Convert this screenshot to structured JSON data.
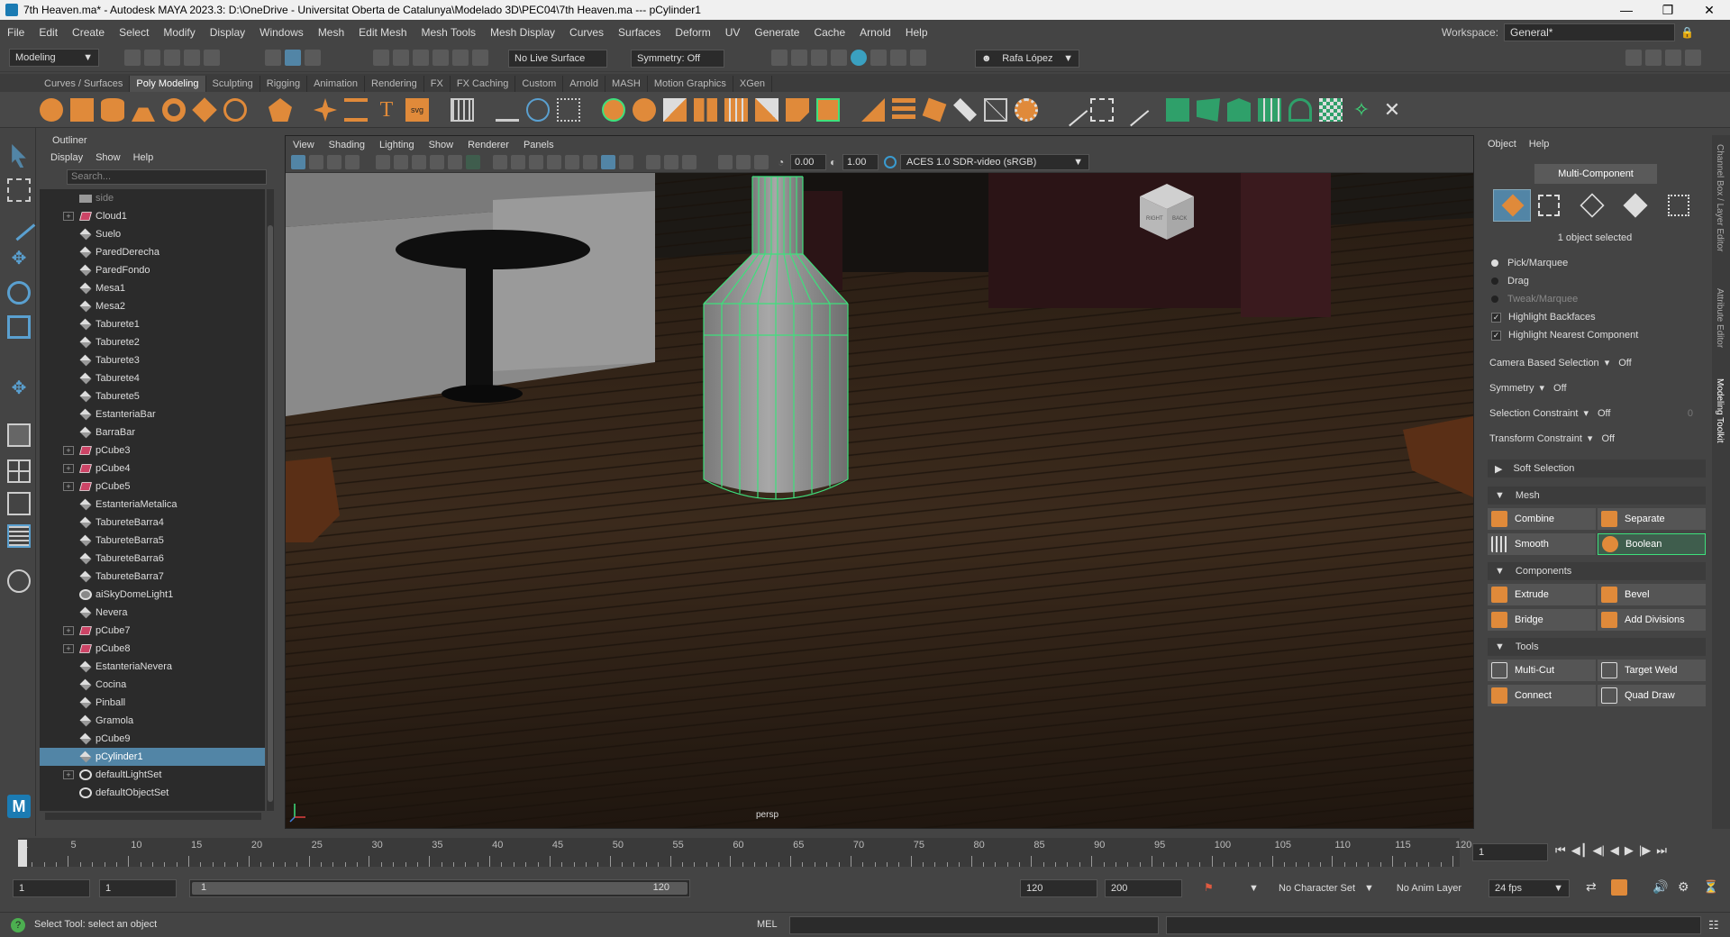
{
  "window": {
    "title": "7th Heaven.ma* - Autodesk MAYA 2023.3: D:\\OneDrive - Universitat Oberta de Catalunya\\Modelado 3D\\PEC04\\7th Heaven.ma   ---   pCylinder1"
  },
  "menubar": {
    "items": [
      "File",
      "Edit",
      "Create",
      "Select",
      "Modify",
      "Display",
      "Windows",
      "Mesh",
      "Edit Mesh",
      "Mesh Tools",
      "Mesh Display",
      "Curves",
      "Surfaces",
      "Deform",
      "UV",
      "Generate",
      "Cache",
      "Arnold",
      "Help"
    ],
    "workspace_label": "Workspace:",
    "workspace_value": "General*"
  },
  "statusline": {
    "mode": "Modeling",
    "live_surface": "No Live Surface",
    "symmetry": "Symmetry: Off",
    "user": "Rafa López"
  },
  "shelf": {
    "tabs": [
      "Curves / Surfaces",
      "Poly Modeling",
      "Sculpting",
      "Rigging",
      "Animation",
      "Rendering",
      "FX",
      "FX Caching",
      "Custom",
      "Arnold",
      "MASH",
      "Motion Graphics",
      "XGen"
    ],
    "active_tab": "Poly Modeling"
  },
  "outliner": {
    "title": "Outliner",
    "menu": [
      "Display",
      "Show",
      "Help"
    ],
    "search_placeholder": "Search...",
    "items": [
      {
        "label": "side",
        "icon": "camera-icon",
        "expandable": false
      },
      {
        "label": "Cloud1",
        "icon": "group-icon",
        "expandable": true
      },
      {
        "label": "Suelo",
        "icon": "mesh-icon",
        "expandable": false
      },
      {
        "label": "ParedDerecha",
        "icon": "mesh-icon",
        "expandable": false
      },
      {
        "label": "ParedFondo",
        "icon": "mesh-icon",
        "expandable": false
      },
      {
        "label": "Mesa1",
        "icon": "mesh-icon",
        "expandable": false
      },
      {
        "label": "Mesa2",
        "icon": "mesh-icon",
        "expandable": false
      },
      {
        "label": "Taburete1",
        "icon": "mesh-icon",
        "expandable": false
      },
      {
        "label": "Taburete2",
        "icon": "mesh-icon",
        "expandable": false
      },
      {
        "label": "Taburete3",
        "icon": "mesh-icon",
        "expandable": false
      },
      {
        "label": "Taburete4",
        "icon": "mesh-icon",
        "expandable": false
      },
      {
        "label": "Taburete5",
        "icon": "mesh-icon",
        "expandable": false
      },
      {
        "label": "EstanteriaBar",
        "icon": "mesh-icon",
        "expandable": false
      },
      {
        "label": "BarraBar",
        "icon": "mesh-icon",
        "expandable": false
      },
      {
        "label": "pCube3",
        "icon": "group-icon",
        "expandable": true
      },
      {
        "label": "pCube4",
        "icon": "group-icon",
        "expandable": true
      },
      {
        "label": "pCube5",
        "icon": "group-icon",
        "expandable": true
      },
      {
        "label": "EstanteriaMetalica",
        "icon": "mesh-icon",
        "expandable": false
      },
      {
        "label": "TabureteBarra4",
        "icon": "mesh-icon",
        "expandable": false
      },
      {
        "label": "TabureteBarra5",
        "icon": "mesh-icon",
        "expandable": false
      },
      {
        "label": "TabureteBarra6",
        "icon": "mesh-icon",
        "expandable": false
      },
      {
        "label": "TabureteBarra7",
        "icon": "mesh-icon",
        "expandable": false
      },
      {
        "label": "aiSkyDomeLight1",
        "icon": "light-icon",
        "expandable": false
      },
      {
        "label": "Nevera",
        "icon": "mesh-icon",
        "expandable": false
      },
      {
        "label": "pCube7",
        "icon": "group-icon",
        "expandable": true
      },
      {
        "label": "pCube8",
        "icon": "group-icon",
        "expandable": true
      },
      {
        "label": "EstanteriaNevera",
        "icon": "mesh-icon",
        "expandable": false
      },
      {
        "label": "Cocina",
        "icon": "mesh-icon",
        "expandable": false
      },
      {
        "label": "Pinball",
        "icon": "mesh-icon",
        "expandable": false
      },
      {
        "label": "Gramola",
        "icon": "mesh-icon",
        "expandable": false
      },
      {
        "label": "pCube9",
        "icon": "mesh-icon",
        "expandable": false
      },
      {
        "label": "pCylinder1",
        "icon": "mesh-icon",
        "expandable": false,
        "selected": true
      },
      {
        "label": "defaultLightSet",
        "icon": "set-icon",
        "expandable": true
      },
      {
        "label": "defaultObjectSet",
        "icon": "set-icon",
        "expandable": false
      }
    ]
  },
  "viewport": {
    "menu": [
      "View",
      "Shading",
      "Lighting",
      "Show",
      "Renderer",
      "Panels"
    ],
    "exposure": "0.00",
    "gamma": "1.00",
    "color_space": "ACES 1.0 SDR-video (sRGB)",
    "camera_label": "persp",
    "viewcube_right": "RIGHT",
    "viewcube_back": "BACK",
    "wire_color": "#3ee07c"
  },
  "toolkit": {
    "menu": [
      "Object",
      "Help"
    ],
    "multi_component": "Multi-Component",
    "selection_info": "1 object selected",
    "pick_marquee": "Pick/Marquee",
    "drag": "Drag",
    "tweak_marquee": "Tweak/Marquee",
    "highlight_backfaces": "Highlight Backfaces",
    "highlight_nearest": "Highlight Nearest Component",
    "camera_based_label": "Camera Based Selection",
    "camera_based_value": "Off",
    "symmetry_label": "Symmetry",
    "symmetry_value": "Off",
    "selection_constraint_label": "Selection Constraint",
    "selection_constraint_value": "Off",
    "selection_constraint_num": "0",
    "transform_constraint_label": "Transform Constraint",
    "transform_constraint_value": "Off",
    "soft_selection": "Soft Selection",
    "mesh_section": "Mesh",
    "mesh_buttons": [
      "Combine",
      "Separate",
      "Smooth",
      "Boolean"
    ],
    "components_section": "Components",
    "component_buttons": [
      "Extrude",
      "Bevel",
      "Bridge",
      "Add Divisions"
    ],
    "tools_section": "Tools",
    "tool_buttons": [
      "Multi-Cut",
      "Target Weld",
      "Connect",
      "Quad Draw"
    ]
  },
  "side_tabs": [
    "Channel Box / Layer Editor",
    "Attribute Editor",
    "Modeling Toolkit"
  ],
  "timeslider": {
    "ticks": [
      "1",
      "5",
      "10",
      "15",
      "20",
      "25",
      "30",
      "35",
      "40",
      "45",
      "50",
      "55",
      "60",
      "65",
      "70",
      "75",
      "80",
      "85",
      "90",
      "95",
      "100",
      "105",
      "110",
      "115",
      "120"
    ],
    "current_frame": "1"
  },
  "range": {
    "start": "1",
    "playback_start": "1",
    "range_start_label": "1",
    "range_end_label": "120",
    "playback_end": "120",
    "end": "200",
    "character_set": "No Character Set",
    "anim_layer": "No Anim Layer",
    "fps": "24 fps"
  },
  "helpline": {
    "message": "Select Tool: select an object",
    "mel_label": "MEL"
  }
}
